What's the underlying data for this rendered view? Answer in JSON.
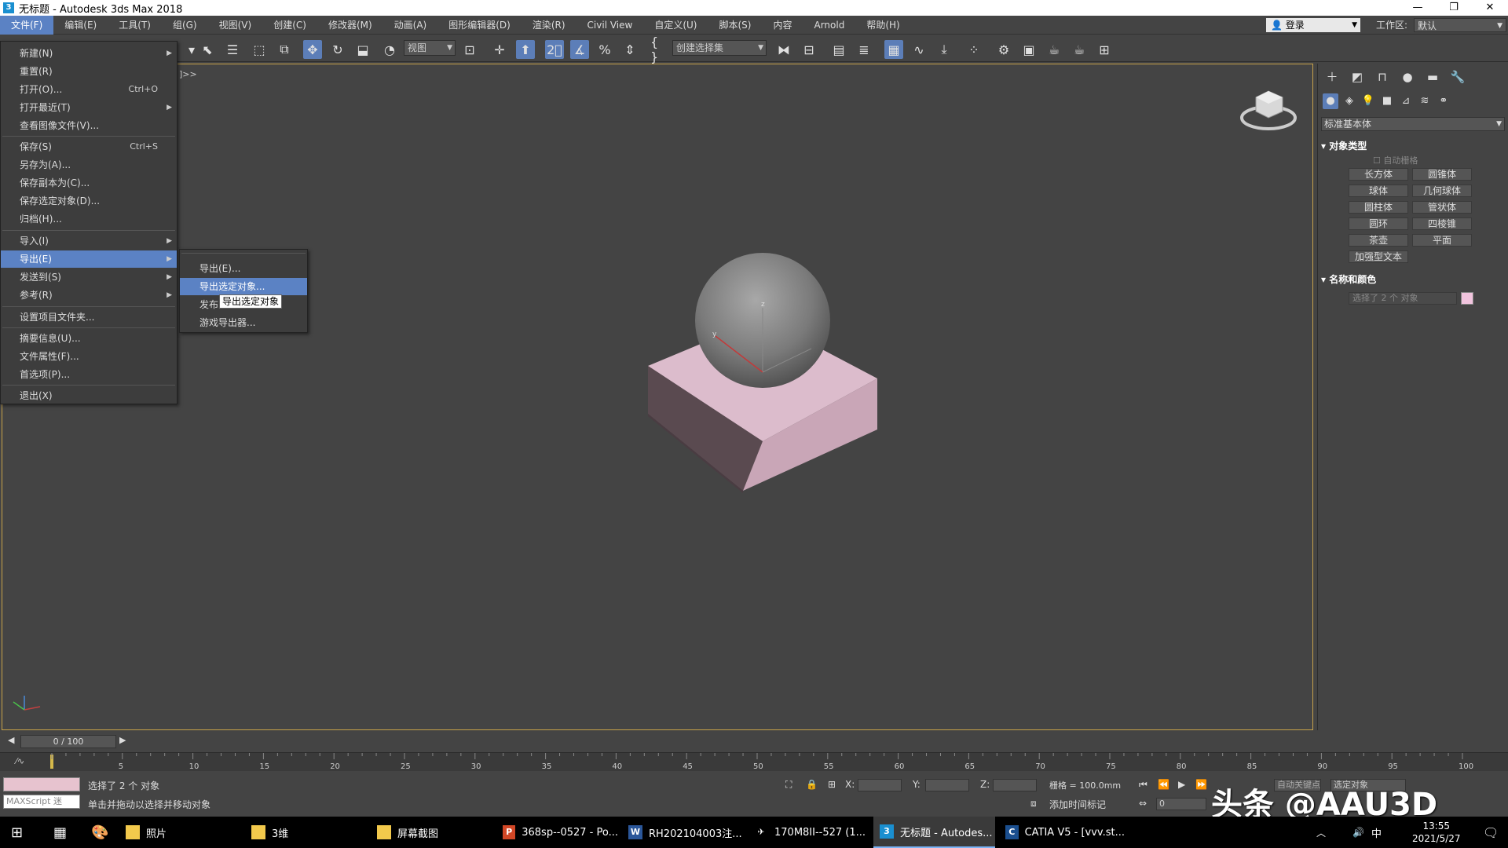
{
  "window": {
    "title": "无标题 - Autodesk 3ds Max 2018",
    "app_icon": "3",
    "minimize": "—",
    "restore": "❐",
    "close": "✕"
  },
  "menubar": {
    "items": [
      "文件(F)",
      "编辑(E)",
      "工具(T)",
      "组(G)",
      "视图(V)",
      "创建(C)",
      "修改器(M)",
      "动画(A)",
      "图形编辑器(D)",
      "渲染(R)",
      "Civil View",
      "自定义(U)",
      "脚本(S)",
      "内容",
      "Arnold",
      "帮助(H)"
    ],
    "login": "登录",
    "workspace_label": "工作区:",
    "workspace_value": "默认"
  },
  "toolbar": {
    "view_dropdown": "视图",
    "selection_set": "创建选择集"
  },
  "viewport": {
    "label": "]>>",
    "border_color": "#c7a24a"
  },
  "file_menu": {
    "items": [
      {
        "label": "新建(N)",
        "submenu": true
      },
      {
        "label": "重置(R)"
      },
      {
        "label": "打开(O)...",
        "shortcut": "Ctrl+O"
      },
      {
        "label": "打开最近(T)",
        "submenu": true
      },
      {
        "label": "查看图像文件(V)..."
      },
      {
        "label": "保存(S)",
        "shortcut": "Ctrl+S"
      },
      {
        "label": "另存为(A)..."
      },
      {
        "label": "保存副本为(C)..."
      },
      {
        "label": "保存选定对象(D)..."
      },
      {
        "label": "归档(H)..."
      },
      {
        "label": "导入(I)",
        "submenu": true
      },
      {
        "label": "导出(E)",
        "submenu": true
      },
      {
        "label": "发送到(S)",
        "submenu": true
      },
      {
        "label": "参考(R)",
        "submenu": true
      },
      {
        "label": "设置项目文件夹..."
      },
      {
        "label": "摘要信息(U)..."
      },
      {
        "label": "文件属性(F)..."
      },
      {
        "label": "首选项(P)..."
      },
      {
        "label": "退出(X)"
      }
    ]
  },
  "export_submenu": {
    "items": [
      "导出(E)...",
      "导出选定对象...",
      "发布",
      "游戏导出器..."
    ],
    "tooltip": "导出选定对象"
  },
  "command_panel": {
    "category": "标准基本体",
    "object_type_title": "对象类型",
    "autogrid": "自动栅格",
    "buttons": [
      "长方体",
      "圆锥体",
      "球体",
      "几何球体",
      "圆柱体",
      "管状体",
      "圆环",
      "四棱锥",
      "茶壶",
      "平面",
      "加强型文本"
    ],
    "name_color_title": "名称和颜色",
    "name_field": "选择了 2 个 对象",
    "object_color": "#e7c3cf"
  },
  "time_slider": {
    "frame": "0 / 100",
    "ticks": [
      "5",
      "10",
      "15",
      "20",
      "25",
      "30",
      "35",
      "40",
      "45",
      "50",
      "55",
      "60",
      "65",
      "70",
      "75",
      "80",
      "85",
      "90",
      "95",
      "100"
    ]
  },
  "status": {
    "selected": "选择了 2 个 对象",
    "prompt": "单击并拖动以选择并移动对象",
    "maxscript": "MAXScript 迷",
    "x_label": "X:",
    "y_label": "Y:",
    "z_label": "Z:",
    "grid": "栅格 = 100.0mm",
    "add_time_tag": "添加时间标记",
    "auto_key": "自动关键点",
    "selected_obj": "选定对象",
    "spinner": "0"
  },
  "taskbar": {
    "items": [
      "照片",
      "3维",
      "屏幕截图",
      "368sp--0527 - Po...",
      "RH202104003注...",
      "170M8II--527 (1...",
      "无标题 - Autodes...",
      "CATIA V5 - [vvv.st..."
    ],
    "time": "13:55",
    "date": "2021/5/27",
    "ime": "中"
  },
  "watermark": "头条 @AAU3D"
}
